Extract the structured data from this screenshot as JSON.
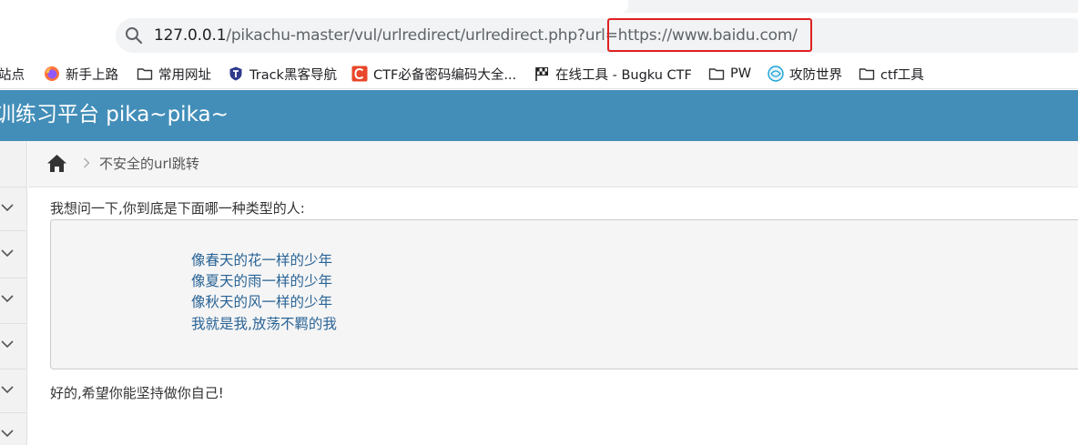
{
  "browser": {
    "url": {
      "host": "127.0.0.1",
      "path": "/pikachu-master/vul/urlredirect/urlredirect.php?url=https://www.baidu.com/"
    },
    "bookmarks": [
      {
        "label": "站点",
        "icon": "globe-icon"
      },
      {
        "label": "新手上路",
        "icon": "firefox-icon"
      },
      {
        "label": "常用网址",
        "icon": "folder-icon"
      },
      {
        "label": "Track黑客导航",
        "icon": "shield-icon"
      },
      {
        "label": "CTF必备密码编码大全...",
        "icon": "c-logo-icon"
      },
      {
        "label": "在线工具 - Bugku CTF",
        "icon": "checkered-flag-icon"
      },
      {
        "label": "PW",
        "icon": "folder-icon"
      },
      {
        "label": "攻防世界",
        "icon": "globe-icon"
      },
      {
        "label": "ctf工具",
        "icon": "folder-icon"
      }
    ]
  },
  "page": {
    "banner_title": "训练习平台 pika~pika~",
    "breadcrumb": "不安全的url跳转",
    "question": "我想问一下,你到底是下面哪一种类型的人:",
    "options": [
      "像春天的花一样的少年",
      "像夏天的雨一样的少年",
      "像秋天的风一样的少年",
      "我就是我,放荡不羁的我"
    ],
    "answer": "好的,希望你能坚持做你自己!"
  },
  "colors": {
    "banner": "#438eb9",
    "link": "#2a6496",
    "highlight": "#e02020"
  }
}
